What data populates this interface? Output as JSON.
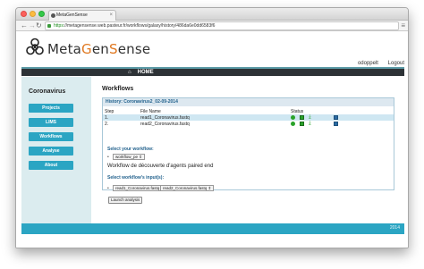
{
  "browser": {
    "tab_title": "MetaGenSense",
    "url_scheme": "https",
    "url_rest": "://metagensense.web.pasteur.fr/workflows/galaxy/history/486da6e0dd6583f6"
  },
  "header": {
    "logo_pre": "Meta",
    "logo_g": "G",
    "logo_post": "en",
    "logo_s": "S",
    "logo_end": "ense",
    "username": "odoppelt",
    "logout": "Logout"
  },
  "navbar": {
    "home": "HOME"
  },
  "sidebar": {
    "title": "Coronavirus",
    "items": [
      {
        "label": "Projects"
      },
      {
        "label": "LIMS"
      },
      {
        "label": "Workflows"
      },
      {
        "label": "Analyse"
      },
      {
        "label": "About"
      }
    ]
  },
  "main": {
    "heading": "Workflows",
    "history_title": "History: Coronavirus2_02-09-2014",
    "columns": [
      "Step",
      "File Name",
      "Status"
    ],
    "rows": [
      {
        "step": "1.",
        "file": "read1_Coronavirus.fastq"
      },
      {
        "step": "2.",
        "file": "read2_Coronavirus.fastq"
      }
    ],
    "select_workflow_label": "Select your workflow:",
    "workflow_value": "workflow_pe",
    "workflow_description": "Workflow de découverte d'agents paired end",
    "select_inputs_label": "Select workflow's input(s):",
    "input1_value": "read1_Coronavirus.fastq",
    "input2_value": "read2_Coronavirus.fastq",
    "launch_label": "Launch analysis"
  },
  "footer": {
    "year": "2014"
  },
  "colors": {
    "accent": "#2ba5c3",
    "navbar": "#2d3236",
    "sidebar_bg": "#dbecef"
  }
}
